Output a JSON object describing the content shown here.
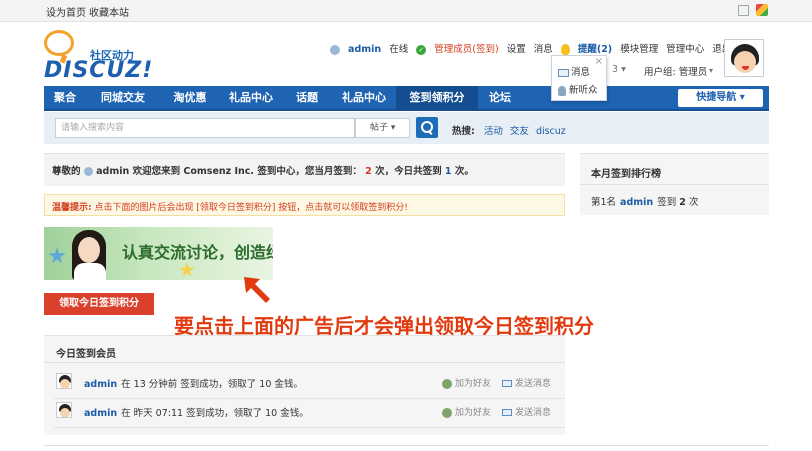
{
  "topbar": {
    "set_homepage": "设为首页",
    "bookmark": "收藏本站"
  },
  "logo": {
    "subtitle": "社区动力",
    "brand": "DISCUZ!"
  },
  "userbar": {
    "username": "admin",
    "online": "在线",
    "role": "管理成员(签到)",
    "settings": "设置",
    "messages": "消息",
    "reminder": "提醒(2)",
    "module_manage": "模块管理",
    "admin_center": "管理中心",
    "logout": "退出",
    "hidden_partial": "3",
    "usergroup": "用户组: 管理员"
  },
  "popup": {
    "item_messages": "消息",
    "item_newbie": "新听众"
  },
  "nav": {
    "items": [
      "聚合",
      "同城交友",
      "淘优惠",
      "礼品中心",
      "话题",
      "礼品中心",
      "签到领积分",
      "论坛"
    ],
    "active_index": 6,
    "quick_nav": "快捷导航"
  },
  "search": {
    "placeholder": "请输入搜索内容",
    "type": "帖子",
    "hot_label": "热搜:",
    "hot_terms": [
      "活动",
      "交友",
      "discuz"
    ]
  },
  "welcome": {
    "prefix": "尊敬的",
    "username": "admin",
    "text1": "欢迎您来到 Comsenz Inc. 签到中心，您当月签到：",
    "month_count": "2",
    "text2": "次，今日共签到",
    "today_count": "1",
    "text3": "次。"
  },
  "tip": {
    "label": "温馨提示:",
    "text": "点击下面的图片后会出现 [领取今日签到积分] 按钮，点击就可以领取签到积分!"
  },
  "banner": {
    "text": "认真交流讨论，创造绿"
  },
  "annotation": "要点击上面的广告后才会弹出领取今日签到积分",
  "claim_button": "领取今日签到积分",
  "members": {
    "title": "今日签到会员",
    "rows": [
      {
        "name": "admin",
        "text": "在 13 分钟前 签到成功，领取了 10 金钱。",
        "add_friend": "加为好友",
        "send_msg": "发送消息"
      },
      {
        "name": "admin",
        "text": "在 昨天 07:11 签到成功，领取了 10 金钱。",
        "add_friend": "加为好友",
        "send_msg": "发送消息"
      }
    ]
  },
  "rank": {
    "title": "本月签到排行榜",
    "place": "第1名",
    "name": "admin",
    "signed": "签到",
    "count": "2",
    "unit": "次"
  }
}
